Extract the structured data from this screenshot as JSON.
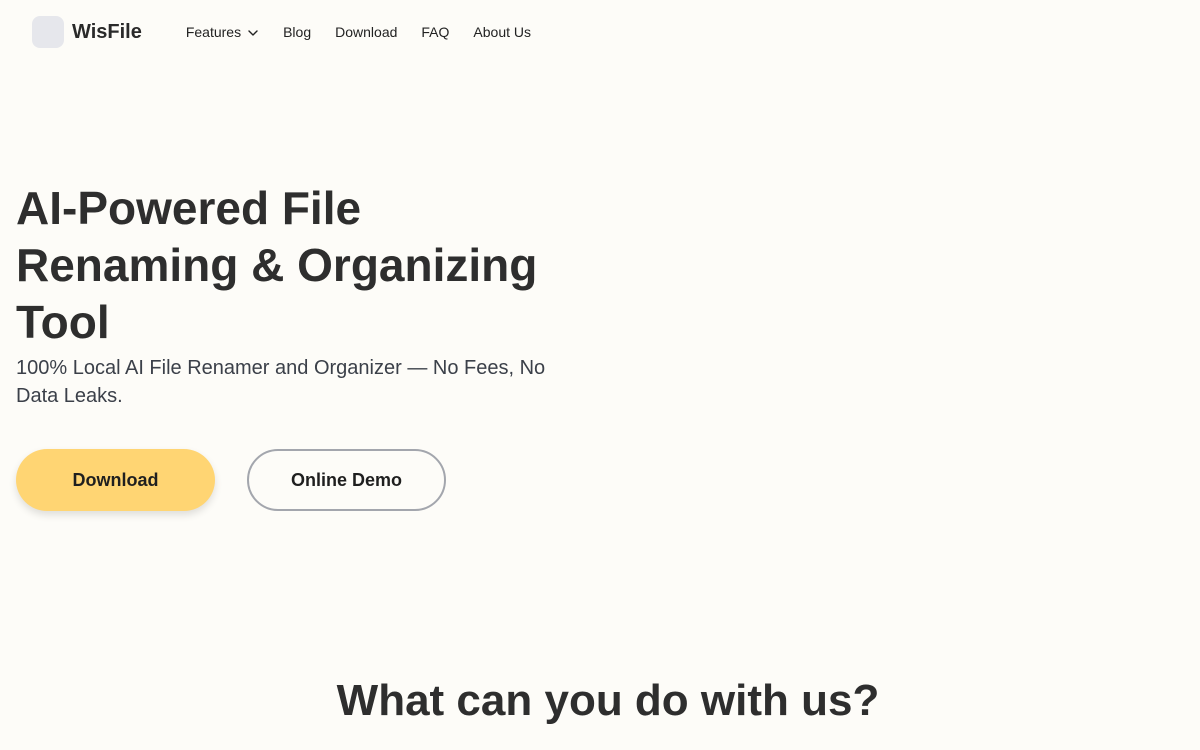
{
  "brand": {
    "name": "WisFile"
  },
  "nav": {
    "items": [
      {
        "label": "Features",
        "has_dropdown": true
      },
      {
        "label": "Blog"
      },
      {
        "label": "Download"
      },
      {
        "label": "FAQ"
      },
      {
        "label": "About Us"
      }
    ]
  },
  "hero": {
    "title": "AI-Powered File Renaming & Organizing Tool",
    "subtitle": "100% Local AI File Renamer and Organizer — No Fees, No Data Leaks.",
    "primary_button": "Download",
    "secondary_button": "Online Demo"
  },
  "section": {
    "title": "What can you do with us?"
  },
  "colors": {
    "background": "#fdfcf8",
    "primary_button": "#ffd573",
    "text": "#2e2e2e"
  },
  "icons": {
    "dropdown": "chevron-down-icon"
  }
}
